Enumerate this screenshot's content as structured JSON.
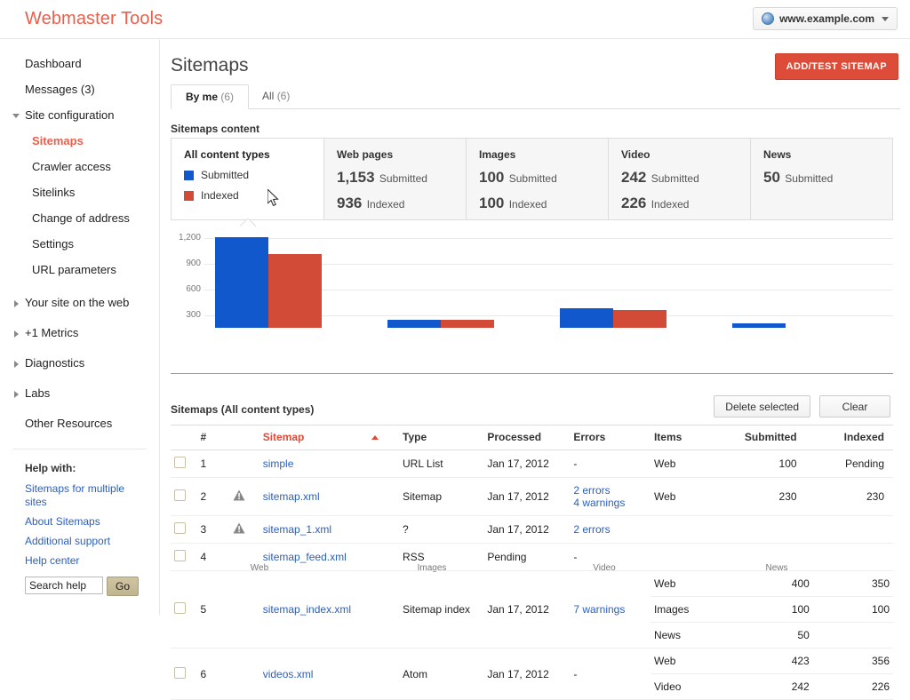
{
  "topbar": {
    "brand": "Webmaster Tools",
    "site_selector": {
      "label": "www.example.com",
      "icon": "globe-icon"
    }
  },
  "sidebar": {
    "items": [
      {
        "label": "Dashboard",
        "type": "link"
      },
      {
        "label": "Messages (3)",
        "type": "link"
      },
      {
        "label": "Site configuration",
        "type": "group",
        "expanded": true
      },
      {
        "label": "Sitemaps",
        "type": "sub",
        "active": true
      },
      {
        "label": "Crawler access",
        "type": "sub"
      },
      {
        "label": "Sitelinks",
        "type": "sub"
      },
      {
        "label": "Change of address",
        "type": "sub"
      },
      {
        "label": "Settings",
        "type": "sub"
      },
      {
        "label": "URL parameters",
        "type": "sub"
      },
      {
        "label": "Your site on the web",
        "type": "group",
        "expanded": false
      },
      {
        "label": "+1 Metrics",
        "type": "group",
        "expanded": false
      },
      {
        "label": "Diagnostics",
        "type": "group",
        "expanded": false
      },
      {
        "label": "Labs",
        "type": "group",
        "expanded": false
      },
      {
        "label": "Other Resources",
        "type": "link"
      }
    ],
    "help": {
      "title": "Help with:",
      "links": [
        "Sitemaps for multiple sites",
        "About Sitemaps",
        "Additional support",
        "Help center"
      ],
      "search_value": "Search help",
      "search_placeholder": "Search help",
      "go_label": "Go"
    }
  },
  "main": {
    "page_title": "Sitemaps",
    "add_test_button": "ADD/TEST SITEMAP",
    "tabs": [
      {
        "label": "By me",
        "count": "(6)",
        "active": true
      },
      {
        "label": "All",
        "count": "(6)",
        "active": false
      }
    ],
    "content_label": "Sitemaps content",
    "cards": [
      {
        "title": "All content types",
        "selected": true,
        "legend": [
          {
            "label": "Submitted",
            "color": "#1158cc"
          },
          {
            "label": "Indexed",
            "color": "#d24b36"
          }
        ]
      },
      {
        "title": "Web pages",
        "submitted": "1,153",
        "submitted_label": "Submitted",
        "indexed": "936",
        "indexed_label": "Indexed"
      },
      {
        "title": "Images",
        "submitted": "100",
        "submitted_label": "Submitted",
        "indexed": "100",
        "indexed_label": "Indexed"
      },
      {
        "title": "Video",
        "submitted": "242",
        "submitted_label": "Submitted",
        "indexed": "226",
        "indexed_label": "Indexed"
      },
      {
        "title": "News",
        "submitted": "50",
        "submitted_label": "Submitted",
        "indexed": "",
        "indexed_label": ""
      }
    ],
    "table_title": "Sitemaps (All content types)",
    "delete_selected_button": "Delete selected",
    "clear_button": "Clear",
    "table_headers": {
      "num": "#",
      "sitemap": "Sitemap",
      "type": "Type",
      "processed": "Processed",
      "errors": "Errors",
      "items": "Items",
      "submitted": "Submitted",
      "indexed": "Indexed"
    },
    "rows": [
      {
        "num": "1",
        "warn": false,
        "name": "simple",
        "type": "URL List",
        "processed": "Jan 17, 2012",
        "errors": [
          "-"
        ],
        "lines": [
          {
            "items": "Web",
            "submitted": "100",
            "indexed": "Pending"
          }
        ]
      },
      {
        "num": "2",
        "warn": true,
        "name": "sitemap.xml",
        "type": "Sitemap",
        "processed": "Jan 17, 2012",
        "errors": [
          "2 errors",
          "4 warnings"
        ],
        "lines": [
          {
            "items": "Web",
            "submitted": "230",
            "indexed": "230"
          }
        ]
      },
      {
        "num": "3",
        "warn": true,
        "name": "sitemap_1.xml",
        "type": "?",
        "processed": "Jan 17, 2012",
        "errors": [
          "2 errors"
        ],
        "lines": [
          {
            "items": "",
            "submitted": "",
            "indexed": ""
          }
        ]
      },
      {
        "num": "4",
        "warn": false,
        "name": "sitemap_feed.xml",
        "type": "RSS",
        "processed": "Pending",
        "errors": [
          "-"
        ],
        "lines": [
          {
            "items": "",
            "submitted": "",
            "indexed": ""
          }
        ]
      },
      {
        "num": "5",
        "warn": false,
        "name": "sitemap_index.xml",
        "type": "Sitemap index",
        "processed": "Jan 17, 2012",
        "errors": [
          "7 warnings"
        ],
        "lines": [
          {
            "items": "Web",
            "submitted": "400",
            "indexed": "350"
          },
          {
            "items": "Images",
            "submitted": "100",
            "indexed": "100"
          },
          {
            "items": "News",
            "submitted": "50",
            "indexed": ""
          }
        ]
      },
      {
        "num": "6",
        "warn": false,
        "name": "videos.xml",
        "type": "Atom",
        "processed": "Jan 17, 2012",
        "errors": [
          "-"
        ],
        "lines": [
          {
            "items": "Web",
            "submitted": "423",
            "indexed": "356"
          },
          {
            "items": "Video",
            "submitted": "242",
            "indexed": "226"
          }
        ]
      }
    ]
  },
  "chart_data": {
    "type": "bar",
    "title": "",
    "categories": [
      "Web",
      "Images",
      "Video",
      "News"
    ],
    "series": [
      {
        "name": "Submitted",
        "color": "#1158cc",
        "values": [
          1153,
          100,
          242,
          50
        ]
      },
      {
        "name": "Indexed",
        "color": "#d24b36",
        "values": [
          936,
          100,
          226,
          0
        ]
      }
    ],
    "yticks": [
      "300",
      "600",
      "900",
      "1,200"
    ],
    "ytick_values": [
      300,
      600,
      900,
      1200
    ],
    "ylim": [
      0,
      1300
    ],
    "xlabel": "",
    "ylabel": "",
    "grid": true,
    "legend_position": "card"
  },
  "colors": {
    "brand": "#e8604c",
    "accent_red": "#dd4b39",
    "submitted_blue": "#1158cc",
    "indexed_red": "#d24b36",
    "link_blue": "#2b5fbd"
  }
}
